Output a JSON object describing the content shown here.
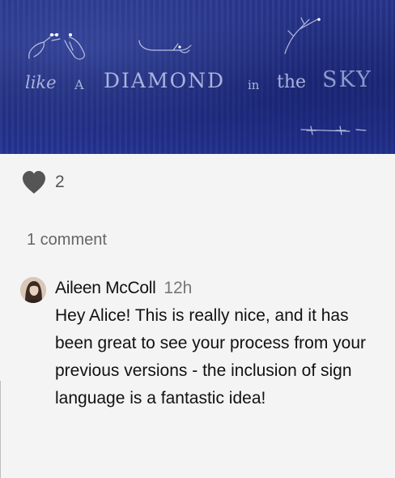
{
  "artwork": {
    "word_like": "like",
    "word_a": "A",
    "word_diamond": "DIAMOND",
    "word_in": "in",
    "word_the": "the",
    "word_sky": "SKY"
  },
  "likes": {
    "icon": "heart-icon",
    "count": "2"
  },
  "comments": {
    "count_label": "1 comment",
    "items": [
      {
        "author": "Aileen McColl",
        "time": "12h",
        "text": "Hey Alice! This is really nice, and it has been great to see your process from your previous versions - the inclusion of sign language is a fantastic idea!"
      }
    ]
  },
  "colors": {
    "artwork_blue": "#253494",
    "page_bg": "#f4f4f4",
    "heart": "#555555"
  }
}
